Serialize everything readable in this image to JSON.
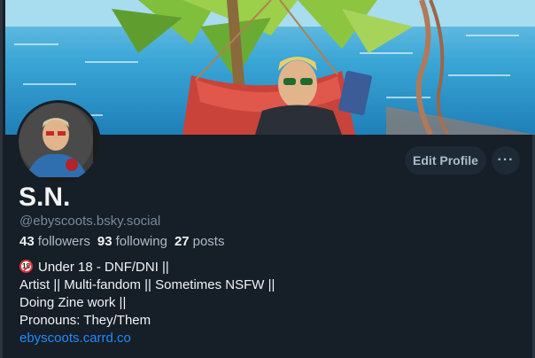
{
  "profile": {
    "display_name": "S.N.",
    "handle": "@ebyscoots.bsky.social",
    "followers_count": "43",
    "followers_label": "followers",
    "following_count": "93",
    "following_label": "following",
    "posts_count": "27",
    "posts_label": "posts"
  },
  "actions": {
    "edit_profile_label": "Edit Profile",
    "more_label": "···"
  },
  "bio": {
    "line1": "Under 18 - DNF/DNI ||",
    "line1_icon": "no-under-18-icon",
    "line2": "Artist || Multi-fandom || Sometimes NSFW ||",
    "line3": "Doing Zine work ||",
    "line4": "Pronouns: They/Them",
    "link": "ebyscoots.carrd.co"
  },
  "colors": {
    "background": "#161e27",
    "button": "#1e2936",
    "link": "#208bfe",
    "muted": "#788a9c"
  }
}
